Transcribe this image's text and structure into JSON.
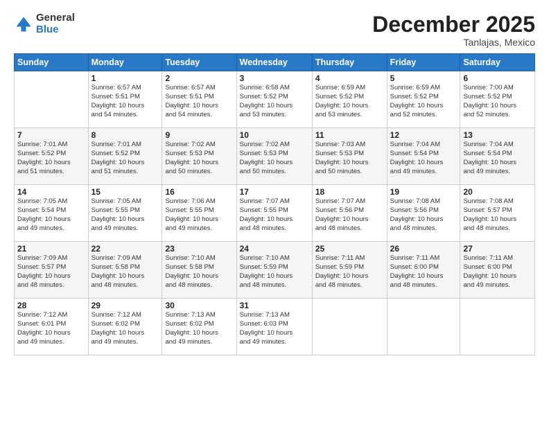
{
  "logo": {
    "general": "General",
    "blue": "Blue"
  },
  "title": "December 2025",
  "location": "Tanlajas, Mexico",
  "days_header": [
    "Sunday",
    "Monday",
    "Tuesday",
    "Wednesday",
    "Thursday",
    "Friday",
    "Saturday"
  ],
  "weeks": [
    [
      {
        "num": "",
        "info": ""
      },
      {
        "num": "1",
        "info": "Sunrise: 6:57 AM\nSunset: 5:51 PM\nDaylight: 10 hours\nand 54 minutes."
      },
      {
        "num": "2",
        "info": "Sunrise: 6:57 AM\nSunset: 5:51 PM\nDaylight: 10 hours\nand 54 minutes."
      },
      {
        "num": "3",
        "info": "Sunrise: 6:58 AM\nSunset: 5:52 PM\nDaylight: 10 hours\nand 53 minutes."
      },
      {
        "num": "4",
        "info": "Sunrise: 6:59 AM\nSunset: 5:52 PM\nDaylight: 10 hours\nand 53 minutes."
      },
      {
        "num": "5",
        "info": "Sunrise: 6:59 AM\nSunset: 5:52 PM\nDaylight: 10 hours\nand 52 minutes."
      },
      {
        "num": "6",
        "info": "Sunrise: 7:00 AM\nSunset: 5:52 PM\nDaylight: 10 hours\nand 52 minutes."
      }
    ],
    [
      {
        "num": "7",
        "info": "Sunrise: 7:01 AM\nSunset: 5:52 PM\nDaylight: 10 hours\nand 51 minutes."
      },
      {
        "num": "8",
        "info": "Sunrise: 7:01 AM\nSunset: 5:52 PM\nDaylight: 10 hours\nand 51 minutes."
      },
      {
        "num": "9",
        "info": "Sunrise: 7:02 AM\nSunset: 5:53 PM\nDaylight: 10 hours\nand 50 minutes."
      },
      {
        "num": "10",
        "info": "Sunrise: 7:02 AM\nSunset: 5:53 PM\nDaylight: 10 hours\nand 50 minutes."
      },
      {
        "num": "11",
        "info": "Sunrise: 7:03 AM\nSunset: 5:53 PM\nDaylight: 10 hours\nand 50 minutes."
      },
      {
        "num": "12",
        "info": "Sunrise: 7:04 AM\nSunset: 5:54 PM\nDaylight: 10 hours\nand 49 minutes."
      },
      {
        "num": "13",
        "info": "Sunrise: 7:04 AM\nSunset: 5:54 PM\nDaylight: 10 hours\nand 49 minutes."
      }
    ],
    [
      {
        "num": "14",
        "info": "Sunrise: 7:05 AM\nSunset: 5:54 PM\nDaylight: 10 hours\nand 49 minutes."
      },
      {
        "num": "15",
        "info": "Sunrise: 7:05 AM\nSunset: 5:55 PM\nDaylight: 10 hours\nand 49 minutes."
      },
      {
        "num": "16",
        "info": "Sunrise: 7:06 AM\nSunset: 5:55 PM\nDaylight: 10 hours\nand 49 minutes."
      },
      {
        "num": "17",
        "info": "Sunrise: 7:07 AM\nSunset: 5:55 PM\nDaylight: 10 hours\nand 48 minutes."
      },
      {
        "num": "18",
        "info": "Sunrise: 7:07 AM\nSunset: 5:56 PM\nDaylight: 10 hours\nand 48 minutes."
      },
      {
        "num": "19",
        "info": "Sunrise: 7:08 AM\nSunset: 5:56 PM\nDaylight: 10 hours\nand 48 minutes."
      },
      {
        "num": "20",
        "info": "Sunrise: 7:08 AM\nSunset: 5:57 PM\nDaylight: 10 hours\nand 48 minutes."
      }
    ],
    [
      {
        "num": "21",
        "info": "Sunrise: 7:09 AM\nSunset: 5:57 PM\nDaylight: 10 hours\nand 48 minutes."
      },
      {
        "num": "22",
        "info": "Sunrise: 7:09 AM\nSunset: 5:58 PM\nDaylight: 10 hours\nand 48 minutes."
      },
      {
        "num": "23",
        "info": "Sunrise: 7:10 AM\nSunset: 5:58 PM\nDaylight: 10 hours\nand 48 minutes."
      },
      {
        "num": "24",
        "info": "Sunrise: 7:10 AM\nSunset: 5:59 PM\nDaylight: 10 hours\nand 48 minutes."
      },
      {
        "num": "25",
        "info": "Sunrise: 7:11 AM\nSunset: 5:59 PM\nDaylight: 10 hours\nand 48 minutes."
      },
      {
        "num": "26",
        "info": "Sunrise: 7:11 AM\nSunset: 6:00 PM\nDaylight: 10 hours\nand 48 minutes."
      },
      {
        "num": "27",
        "info": "Sunrise: 7:11 AM\nSunset: 6:00 PM\nDaylight: 10 hours\nand 49 minutes."
      }
    ],
    [
      {
        "num": "28",
        "info": "Sunrise: 7:12 AM\nSunset: 6:01 PM\nDaylight: 10 hours\nand 49 minutes."
      },
      {
        "num": "29",
        "info": "Sunrise: 7:12 AM\nSunset: 6:02 PM\nDaylight: 10 hours\nand 49 minutes."
      },
      {
        "num": "30",
        "info": "Sunrise: 7:13 AM\nSunset: 6:02 PM\nDaylight: 10 hours\nand 49 minutes."
      },
      {
        "num": "31",
        "info": "Sunrise: 7:13 AM\nSunset: 6:03 PM\nDaylight: 10 hours\nand 49 minutes."
      },
      {
        "num": "",
        "info": ""
      },
      {
        "num": "",
        "info": ""
      },
      {
        "num": "",
        "info": ""
      }
    ]
  ]
}
